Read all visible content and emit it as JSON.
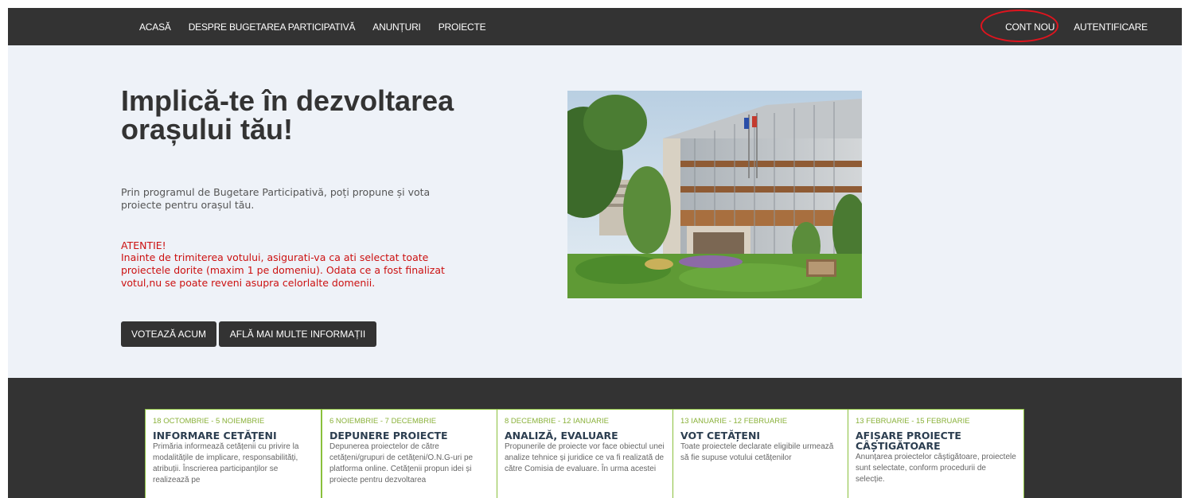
{
  "nav": {
    "left": [
      "ACASĂ",
      "DESPRE BUGETAREA PARTICIPATIVĂ",
      "ANUNȚURI",
      "PROIECTE"
    ],
    "right": [
      "CONT NOU",
      "AUTENTIFICARE"
    ],
    "highlight_color": "#e0141e"
  },
  "hero": {
    "title": "Implică-te în dezvoltarea orașului tău!",
    "text": "Prin programul de Bugetare Participativă, poți propune și vota proiecte pentru orașul tău.",
    "warning_title": "ATENTIE!",
    "warning_text": "Inainte de trimiterea votului, asigurati-va ca ati selectat toate proiectele dorite (maxim 1 pe domeniu). Odata ce a fost finalizat votul,nu se poate reveni asupra celorlalte domenii.",
    "vote_button": "VOTEAZĂ ACUM",
    "info_button": "AFLĂ MAI MULTE INFORMAȚII"
  },
  "timeline": [
    {
      "date": "18 OCTOMBRIE - 5 NOIEMBRIE",
      "title": "INFORMARE CETĂȚENI",
      "text": "Primăria informează cetățenii cu privire la modalitățile de implicare, responsabilități, atribuții. Înscrierea participanților se realizează pe"
    },
    {
      "date": "6 NOIEMBRIE - 7 DECEMBRIE",
      "title": "DEPUNERE PROIECTE",
      "text": "Depunerea proiectelor de către cetățeni/grupuri de cetățeni/O.N.G-uri pe platforma online. Cetățenii propun idei și proiecte pentru dezvoltarea"
    },
    {
      "date": "8 DECEMBRIE - 12 IANUARIE",
      "title": "ANALIZĂ, EVALUARE",
      "text": "Propunerile de proiecte vor face obiectul unei analize tehnice și juridice ce va fi realizată de către Comisia de evaluare. În urma acestei"
    },
    {
      "date": "13 IANUARIE - 12 FEBRUARIE",
      "title": "VOT CETĂȚENI",
      "text": "Toate proiectele declarate eligibile urmează să fie supuse votului cetățenilor"
    },
    {
      "date": "13 FEBRUARIE - 15 FEBRUARIE",
      "title": "AFIȘARE PROIECTE CÂȘTIGĂTOARE",
      "text": "Anunțarea proiectelor câștigătoare, proiectele sunt selectate, conform procedurii de selecție."
    }
  ]
}
